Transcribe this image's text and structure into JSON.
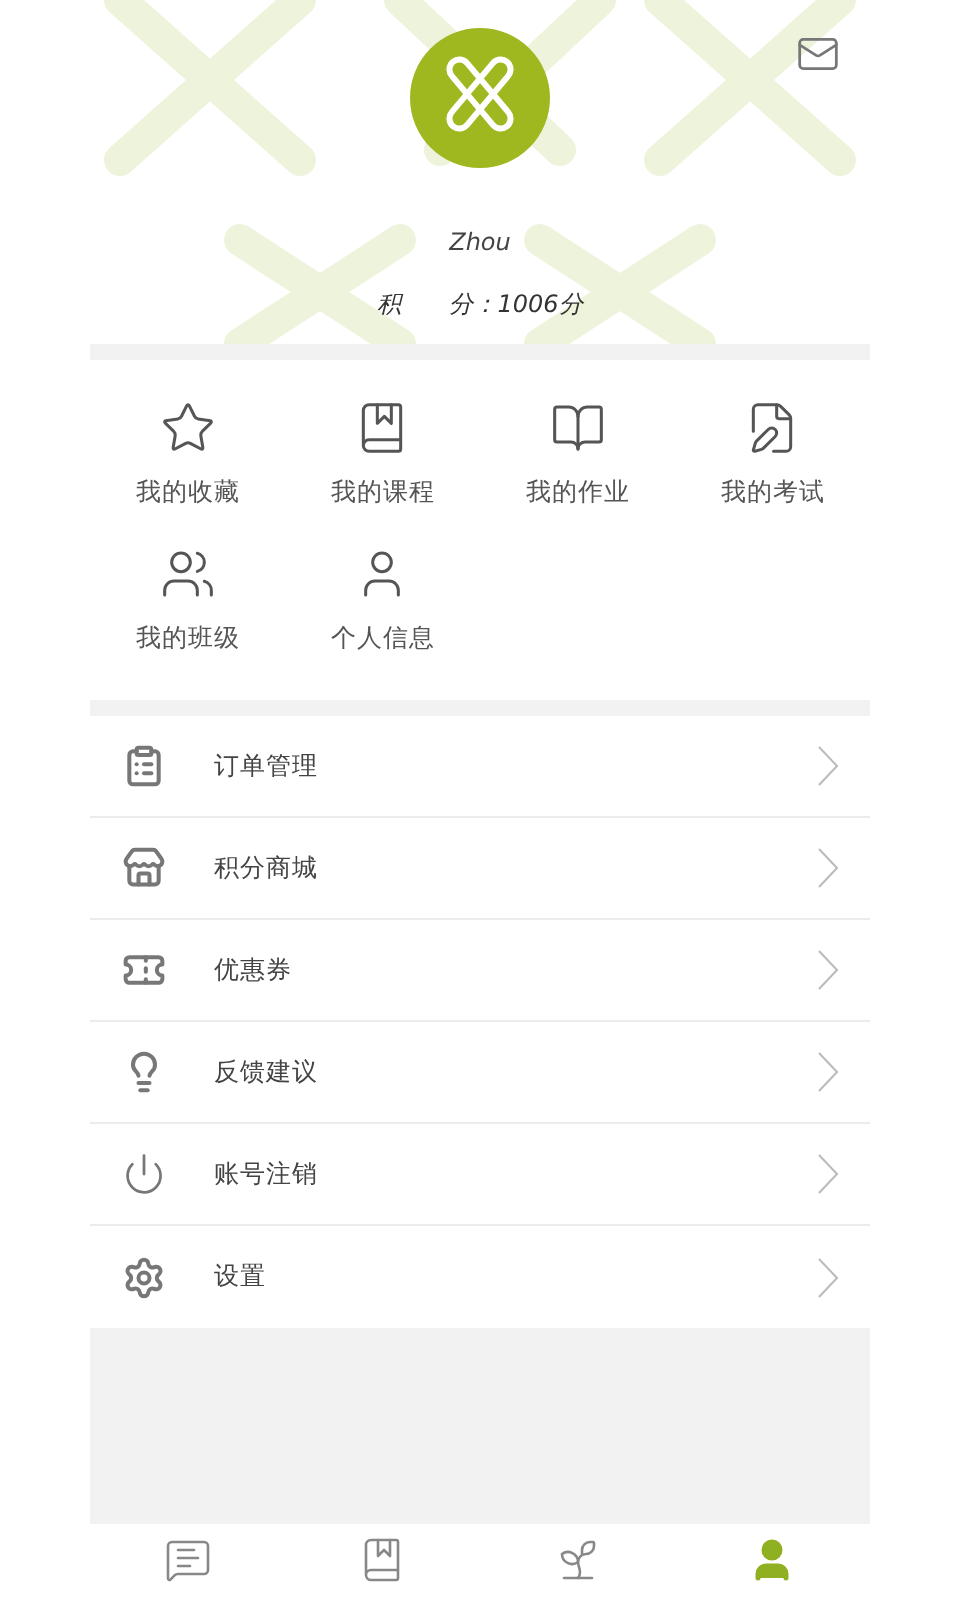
{
  "profile": {
    "name": "Zhou",
    "points": "积　　分：1006分"
  },
  "shortcuts": [
    {
      "label": "我的收藏"
    },
    {
      "label": "我的课程"
    },
    {
      "label": "我的作业"
    },
    {
      "label": "我的考试"
    },
    {
      "label": "我的班级"
    },
    {
      "label": "个人信息"
    }
  ],
  "menu": [
    {
      "label": "订单管理"
    },
    {
      "label": "积分商城"
    },
    {
      "label": "优惠券"
    },
    {
      "label": "反馈建议"
    },
    {
      "label": "账号注销"
    },
    {
      "label": "设置"
    }
  ],
  "bottom_nav": [
    {
      "selected": false
    },
    {
      "selected": false
    },
    {
      "selected": false
    },
    {
      "selected": true
    }
  ]
}
